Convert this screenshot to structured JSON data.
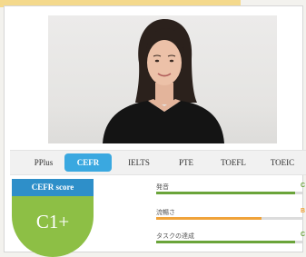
{
  "tabs": [
    {
      "label": "PPlus",
      "active": false
    },
    {
      "label": "CEFR",
      "active": true
    },
    {
      "label": "IELTS",
      "active": false
    },
    {
      "label": "PTE",
      "active": false
    },
    {
      "label": "TOEFL",
      "active": false
    },
    {
      "label": "TOEIC",
      "active": false
    }
  ],
  "score": {
    "title": "CEFR score",
    "value": "C1+"
  },
  "metrics": [
    {
      "label": "発音",
      "value": "C",
      "level": 0.95,
      "color": "#6aa43a"
    },
    {
      "label": "流暢さ",
      "value": "B",
      "level": 0.72,
      "color": "#f0a33a"
    },
    {
      "label": "タスクの達成",
      "value": "C",
      "level": 0.95,
      "color": "#6aa43a"
    }
  ],
  "colors": {
    "accent_blue": "#3aa8e0",
    "score_green": "#8dbf45",
    "header_blue": "#2e8fc9"
  }
}
